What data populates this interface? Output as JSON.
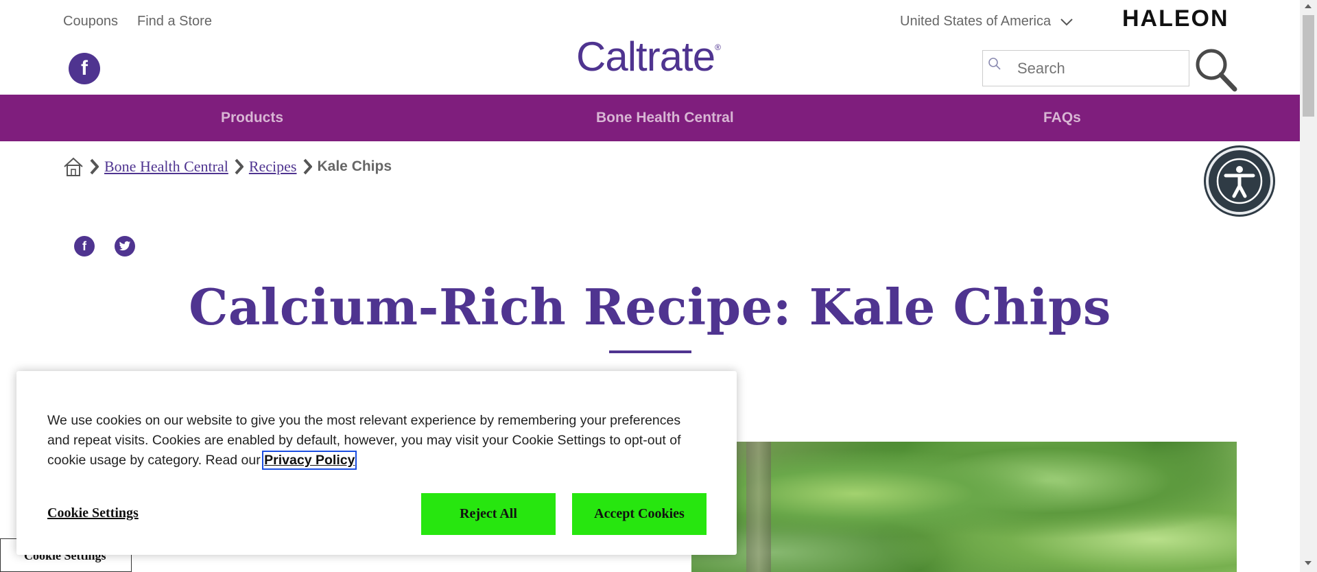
{
  "utility_nav": {
    "coupons": "Coupons",
    "find_store": "Find a Store",
    "country": "United States of America"
  },
  "brand": {
    "logo_text": "Caltrate",
    "registered_mark": "®",
    "corporate_logo": "HALEON"
  },
  "search": {
    "placeholder": "Search"
  },
  "main_nav": {
    "items": [
      {
        "label": "Products"
      },
      {
        "label": "Bone Health Central"
      },
      {
        "label": "FAQs"
      }
    ]
  },
  "breadcrumb": {
    "items": [
      "Bone Health Central",
      "Recipes",
      "Kale Chips"
    ]
  },
  "page": {
    "title": "Calcium-Rich Recipe: Kale Chips"
  },
  "cookie_banner": {
    "message": "We use cookies on our website to give you the most relevant experience by remembering your preferences and repeat visits. Cookies are enabled by default, however, you may visit your Cookie Settings to opt-out of cookie usage by category. Read our",
    "privacy_link": "Privacy Policy",
    "settings_label": "Cookie Settings",
    "reject_label": "Reject All",
    "accept_label": "Accept Cookies"
  },
  "cookie_tab": {
    "label": "Cookie Settings"
  },
  "colors": {
    "brand_purple": "#4f3490",
    "nav_bg": "#7f1e7d",
    "nav_text": "#d8b6d4",
    "button_green": "#27e60f",
    "a11y_bg": "#2f3b45"
  },
  "icons": {
    "facebook": "facebook-icon",
    "twitter": "twitter-icon",
    "home": "home-icon",
    "chevron": "chevron-right-icon",
    "search": "search-icon",
    "accessibility": "accessibility-icon"
  }
}
